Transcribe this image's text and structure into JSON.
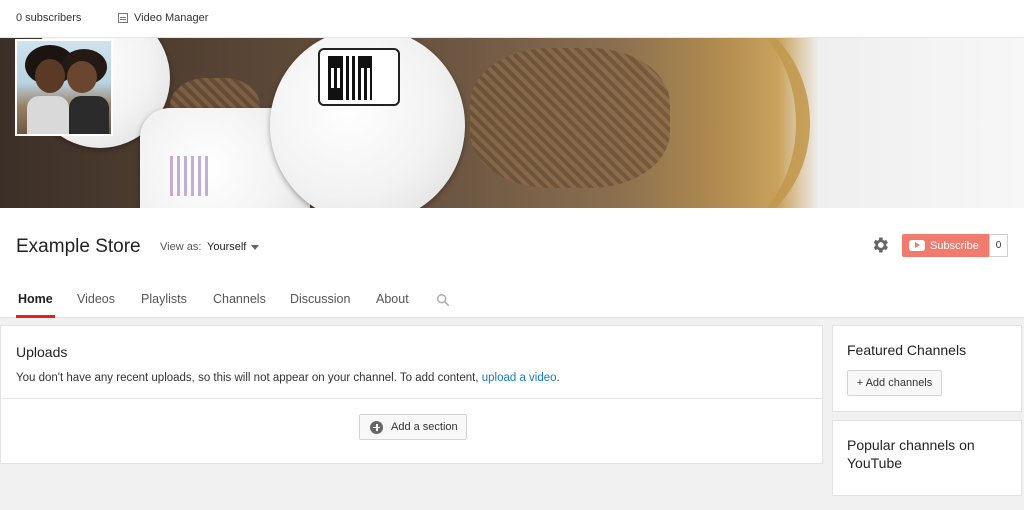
{
  "topbar": {
    "subscribers": "0 subscribers",
    "video_manager": "Video Manager"
  },
  "channel": {
    "name": "Example Store",
    "view_as_label": "View as:",
    "view_as_value": "Yourself",
    "subscribe_label": "Subscribe",
    "subscriber_count": "0"
  },
  "tabs": [
    {
      "label": "Home",
      "active": true
    },
    {
      "label": "Videos"
    },
    {
      "label": "Playlists"
    },
    {
      "label": "Channels"
    },
    {
      "label": "Discussion"
    },
    {
      "label": "About"
    }
  ],
  "uploads": {
    "title": "Uploads",
    "message": "You don't have any recent uploads, so this will not appear on your channel. To add content,",
    "link": "upload a video",
    "trailing": ".",
    "add_section": "Add a section"
  },
  "sidebar": {
    "featured_title": "Featured Channels",
    "add_channels": "+ Add channels",
    "popular_title": "Popular channels on YouTube"
  },
  "colors": {
    "subscribe_bg": "#f27b6f",
    "active_tab": "#e62117",
    "link": "#167ac6"
  }
}
